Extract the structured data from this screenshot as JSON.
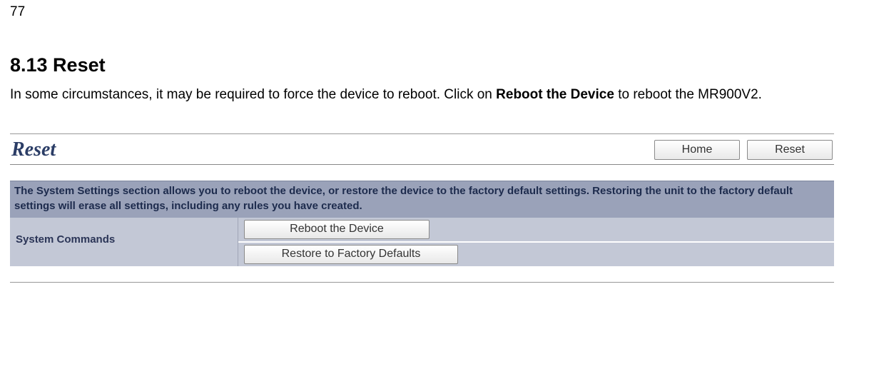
{
  "page_number": "77",
  "section_title": "8.13 Reset",
  "section_body_part1": "In some circumstances, it may be required to force the device to reboot. Click on ",
  "section_body_bold": "Reboot the Device",
  "section_body_part2": " to reboot the MR900V2.",
  "panel": {
    "title": "Reset",
    "buttons": {
      "home": "Home",
      "reset": "Reset"
    },
    "info_text": "The System Settings section allows you to reboot the device, or restore the device to the factory default settings. Restoring the unit to the factory default settings will erase all settings, including any rules you have created.",
    "system_commands_label": "System Commands",
    "actions": {
      "reboot": "Reboot the Device",
      "restore": "Restore to Factory Defaults"
    }
  }
}
